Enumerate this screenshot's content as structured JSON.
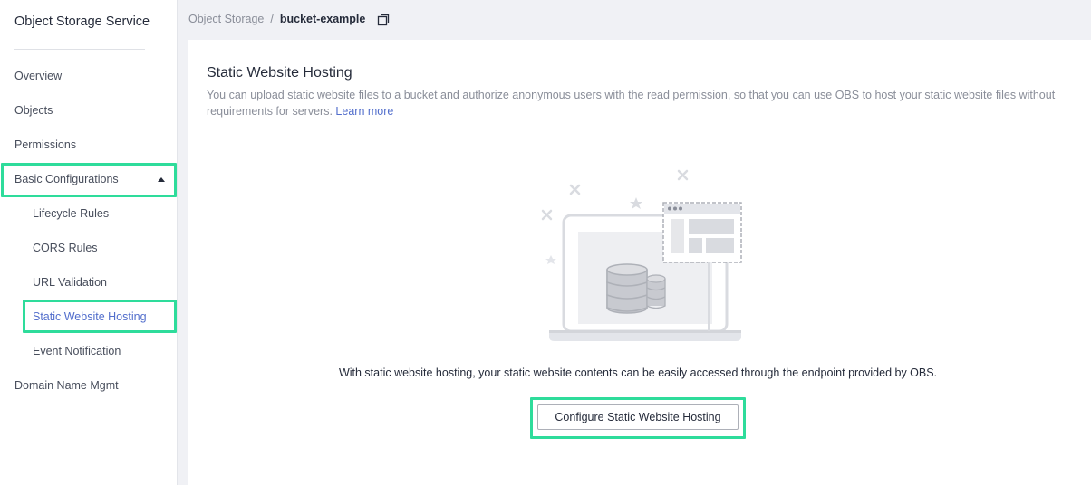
{
  "sidebar": {
    "title": "Object Storage Service",
    "items": [
      {
        "label": "Overview"
      },
      {
        "label": "Objects"
      },
      {
        "label": "Permissions"
      },
      {
        "label": "Basic Configurations"
      },
      {
        "label": "Domain Name Mgmt"
      }
    ],
    "basic_configurations": {
      "expanded": true,
      "children": [
        {
          "label": "Lifecycle Rules"
        },
        {
          "label": "CORS Rules"
        },
        {
          "label": "URL Validation"
        },
        {
          "label": "Static Website Hosting",
          "active": true
        },
        {
          "label": "Event Notification"
        }
      ]
    }
  },
  "breadcrumb": {
    "root": "Object Storage",
    "separator": "/",
    "current": "bucket-example"
  },
  "main": {
    "title": "Static Website Hosting",
    "description": "You can upload static website files to a bucket and authorize anonymous users with the read permission, so that you can use OBS to host your static website files without requirements for servers.",
    "learn_more": "Learn more",
    "empty_text": "With static website hosting, your static website contents can be easily accessed through the endpoint provided by OBS.",
    "configure_button": "Configure Static Website Hosting"
  },
  "icons": {
    "copy": "copy-icon",
    "caret": "caret-up-icon",
    "illustration": "laptop-database-illustration"
  },
  "colors": {
    "accent": "#526ecc",
    "highlight": "#2edc9b",
    "background": "#f0f1f5",
    "muted_text": "#8a8e99"
  }
}
